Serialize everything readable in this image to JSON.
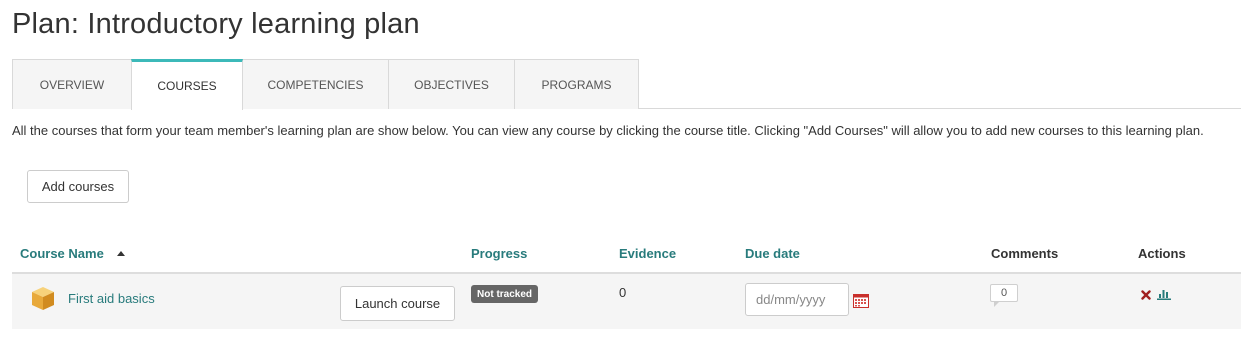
{
  "page": {
    "title": "Plan: Introductory learning plan"
  },
  "tabs": [
    {
      "label": "OVERVIEW"
    },
    {
      "label": "COURSES",
      "active": true
    },
    {
      "label": "COMPETENCIES"
    },
    {
      "label": "OBJECTIVES"
    },
    {
      "label": "PROGRAMS"
    }
  ],
  "description": "All the courses that form your team member's learning plan are show below. You can view any course by clicking the course title. Clicking \"Add Courses\" will allow you to add new courses to this learning plan.",
  "add_button": {
    "label": "Add courses"
  },
  "table": {
    "headers": {
      "course_name": "Course Name",
      "progress": "Progress",
      "evidence": "Evidence",
      "due_date": "Due date",
      "comments": "Comments",
      "actions": "Actions"
    },
    "sort_icon": "sort-ascending-icon",
    "rows": [
      {
        "course_name": "First aid basics",
        "course_icon": "course-box-icon",
        "launch_label": "Launch course",
        "progress": "Not tracked",
        "evidence": "0",
        "due_date_value": "",
        "due_date_placeholder": "dd/mm/yyyy",
        "comments_count": "0",
        "actions": [
          "delete-icon",
          "stats-icon"
        ]
      }
    ]
  },
  "colors": {
    "accent_tab": "#3cb9b9",
    "link": "#287b7c",
    "badge_bg": "#666666",
    "delete": "#a02020",
    "row_bg": "#f5f5f5"
  }
}
